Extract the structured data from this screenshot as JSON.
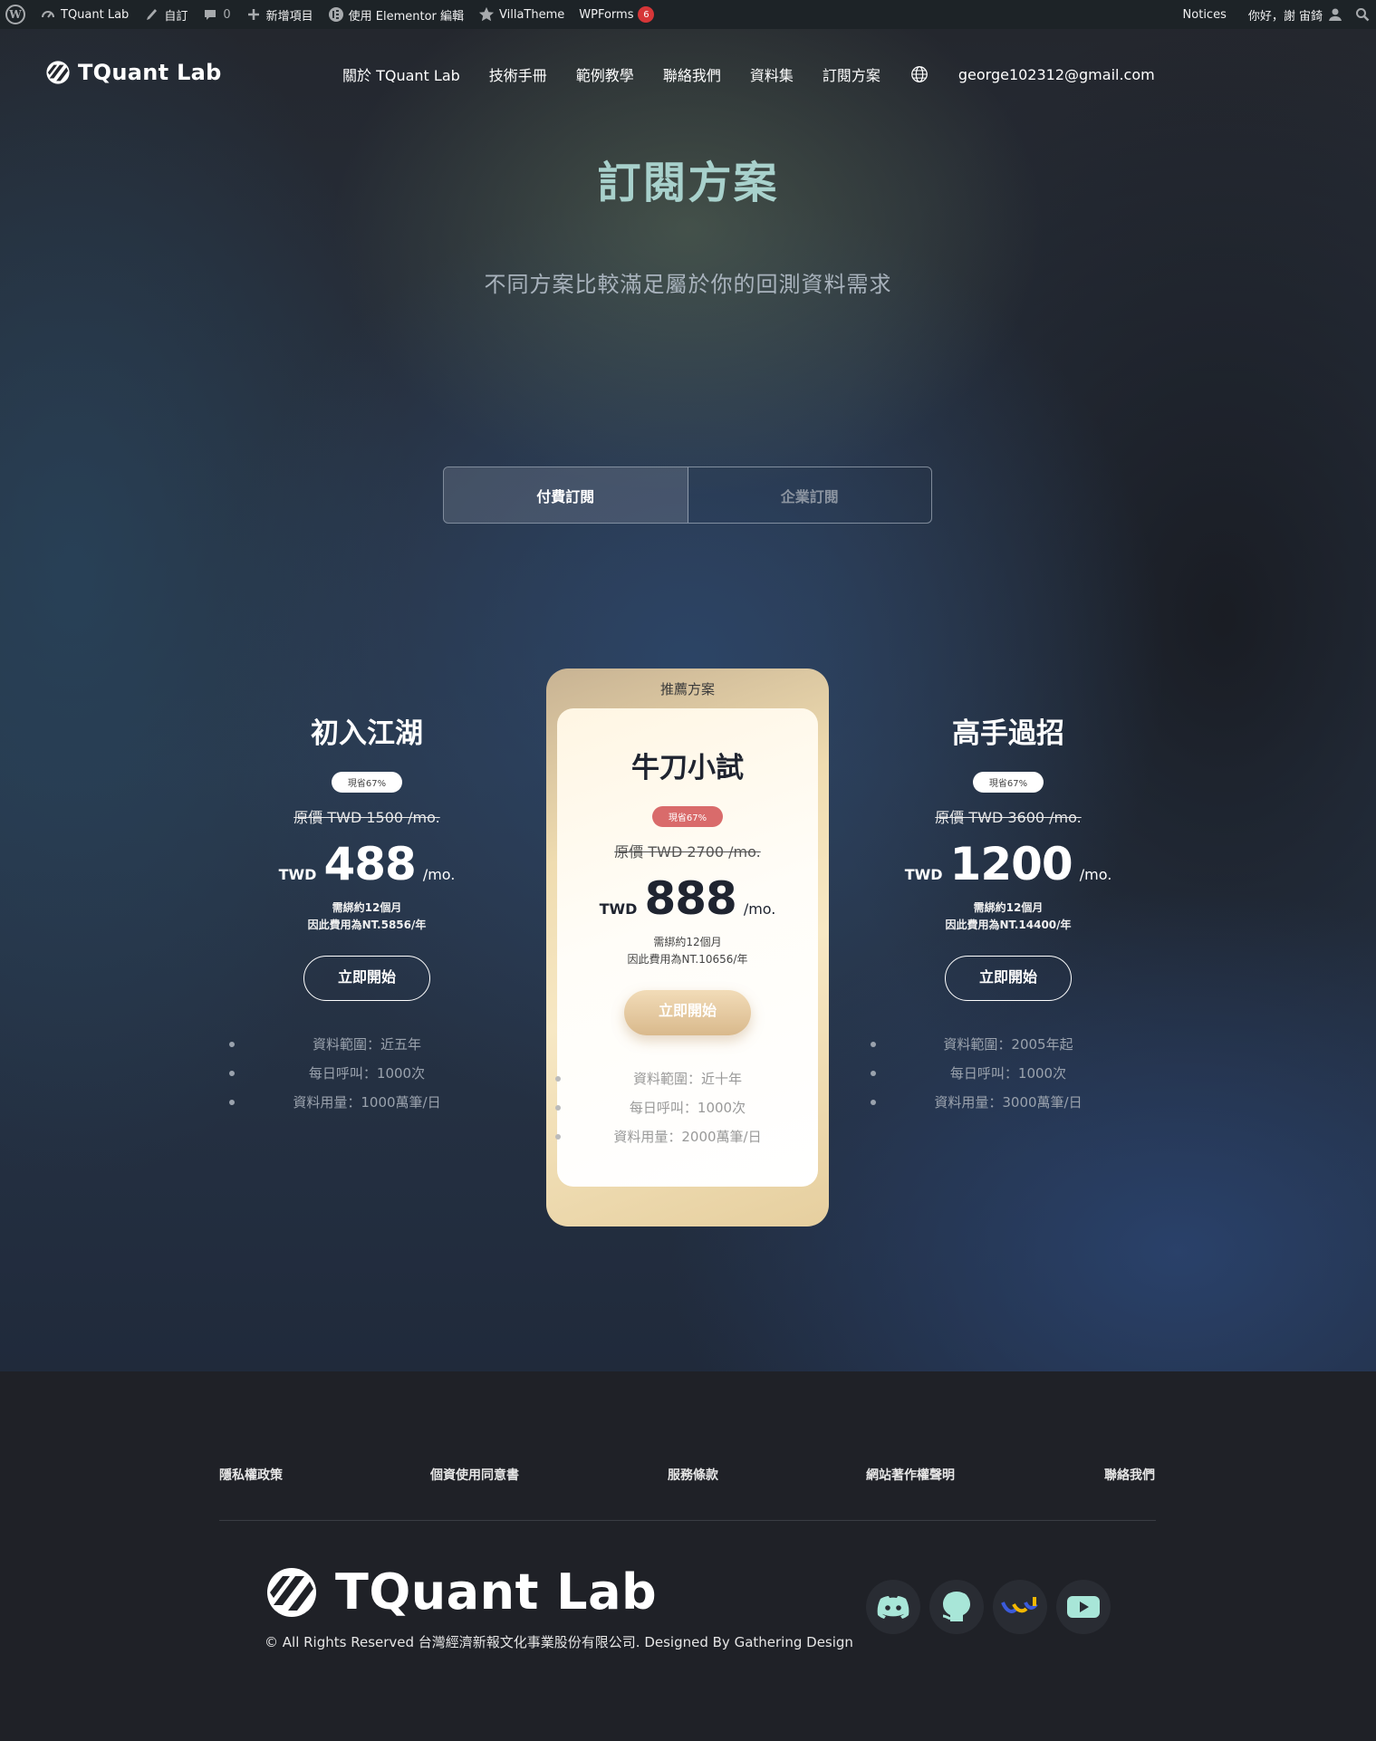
{
  "adminbar": {
    "site_name": "TQuant Lab",
    "customize": "自訂",
    "comments_count": "0",
    "new_item": "新增項目",
    "elementor": "使用 Elementor 編輯",
    "villatheme": "VillaTheme",
    "wpforms": "WPForms",
    "wpforms_badge": "6",
    "notices": "Notices",
    "greeting": "你好，謝 宙錡"
  },
  "nav": {
    "brand": "TQuant Lab",
    "items": [
      "關於 TQuant Lab",
      "技術手冊",
      "範例教學",
      "聯絡我們",
      "資料集",
      "訂閱方案"
    ],
    "email": "george102312@gmail.com"
  },
  "hero": {
    "title": "訂閱方案",
    "subtitle": "不同方案比較滿足屬於你的回測資料需求"
  },
  "toggle": {
    "paid": "付費訂閱",
    "enterprise": "企業訂閱"
  },
  "plans": [
    {
      "name": "初入江湖",
      "save": "現省67%",
      "original": "原價 TWD 1500 /mo.",
      "currency": "TWD",
      "price": "488",
      "per": "/mo.",
      "bind1": "需綁約12個月",
      "bind2": "因此費用為NT.5856/年",
      "cta": "立即開始",
      "features": [
        "資料範圍：近五年",
        "每日呼叫：1000次",
        "資料用量：1000萬筆/日"
      ]
    },
    {
      "tag": "推薦方案",
      "name": "牛刀小試",
      "save": "現省67%",
      "original": "原價 TWD 2700 /mo.",
      "currency": "TWD",
      "price": "888",
      "per": "/mo.",
      "bind1": "需綁約12個月",
      "bind2": "因此費用為NT.10656/年",
      "cta": "立即開始",
      "features": [
        "資料範圍：近十年",
        "每日呼叫：1000次",
        "資料用量：2000萬筆/日"
      ]
    },
    {
      "name": "高手過招",
      "save": "現省67%",
      "original": "原價 TWD 3600 /mo.",
      "currency": "TWD",
      "price": "1200",
      "per": "/mo.",
      "bind1": "需綁約12個月",
      "bind2": "因此費用為NT.14400/年",
      "cta": "立即開始",
      "features": [
        "資料範圍：2005年起",
        "每日呼叫：1000次",
        "資料用量：3000萬筆/日"
      ]
    }
  ],
  "footer": {
    "links": [
      "隱私權政策",
      "個資使用同意書",
      "服務條款",
      "網站著作權聲明",
      "聯絡我們"
    ],
    "brand": "TQuant Lab",
    "copyright": "© All Rights Reserved 台灣經濟新報文化事業股份有限公司. Designed By Gathering Design",
    "socials": [
      "discord-icon",
      "github-icon",
      "tej-icon",
      "youtube-icon"
    ]
  },
  "colors": {
    "title": "#a8d1cc",
    "featured_gold": "#efdcb0",
    "save_badge_featured": "#d96b6b",
    "social_icon": "#a8e6d8"
  }
}
